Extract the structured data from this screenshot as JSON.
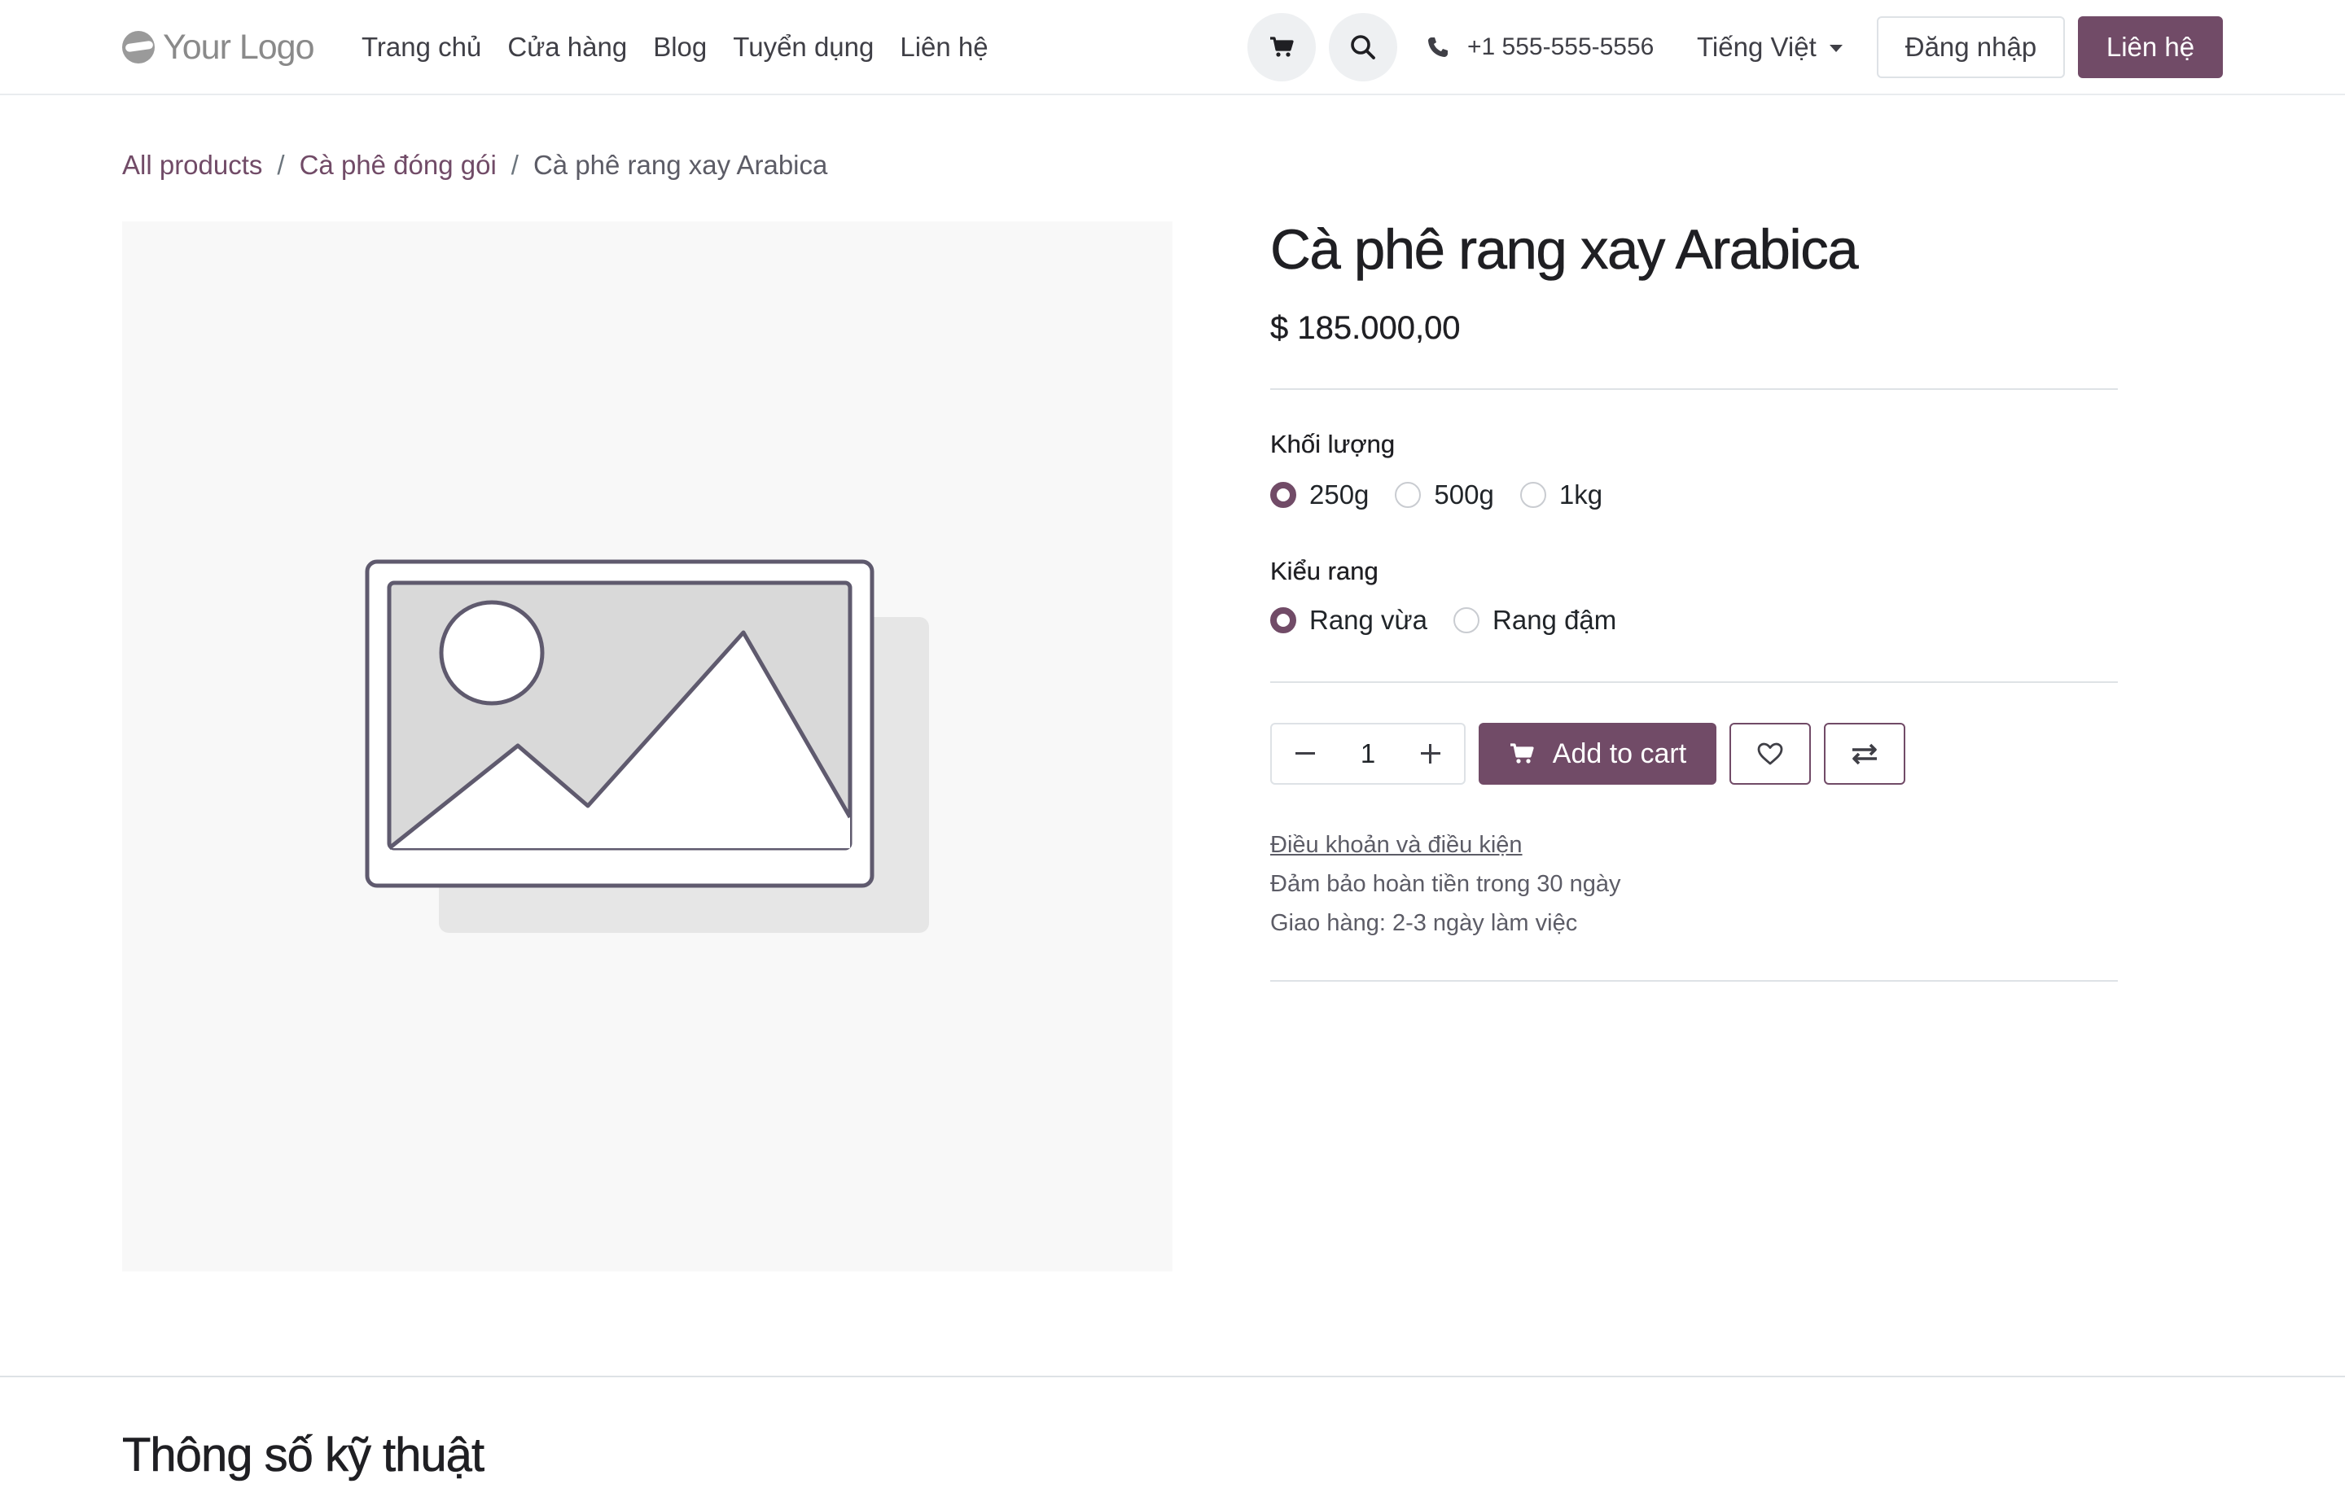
{
  "header": {
    "logo_text": "Your Logo",
    "nav": [
      "Trang chủ",
      "Cửa hàng",
      "Blog",
      "Tuyển dụng",
      "Liên hệ"
    ],
    "phone": "+1 555-555-5556",
    "language": "Tiếng Việt",
    "login_label": "Đăng nhập",
    "contact_label": "Liên hệ",
    "icons": [
      "cart-icon",
      "search-icon",
      "phone-icon"
    ]
  },
  "breadcrumb": {
    "items": [
      "All products",
      "Cà phê đóng gói"
    ],
    "current": "Cà phê rang xay Arabica"
  },
  "product": {
    "title": "Cà phê rang xay Arabica",
    "price": "$ 185.000,00",
    "attributes": [
      {
        "label": "Khối lượng",
        "options": [
          "250g",
          "500g",
          "1kg"
        ],
        "selected": "250g"
      },
      {
        "label": "Kiểu rang",
        "options": [
          "Rang vừa",
          "Rang đậm"
        ],
        "selected": "Rang vừa"
      }
    ],
    "quantity": "1",
    "add_to_cart_label": "Add to cart",
    "terms_link": "Điều khoản và điều kiện",
    "info_lines": [
      "Đảm bảo hoàn tiền trong 30 ngày",
      "Giao hàng: 2-3 ngày làm việc"
    ]
  },
  "specs": {
    "title": "Thông số kỹ thuật"
  },
  "colors": {
    "primary": "#714b67",
    "image_bg": "#f8f8f8",
    "divider": "#dee2e6"
  }
}
